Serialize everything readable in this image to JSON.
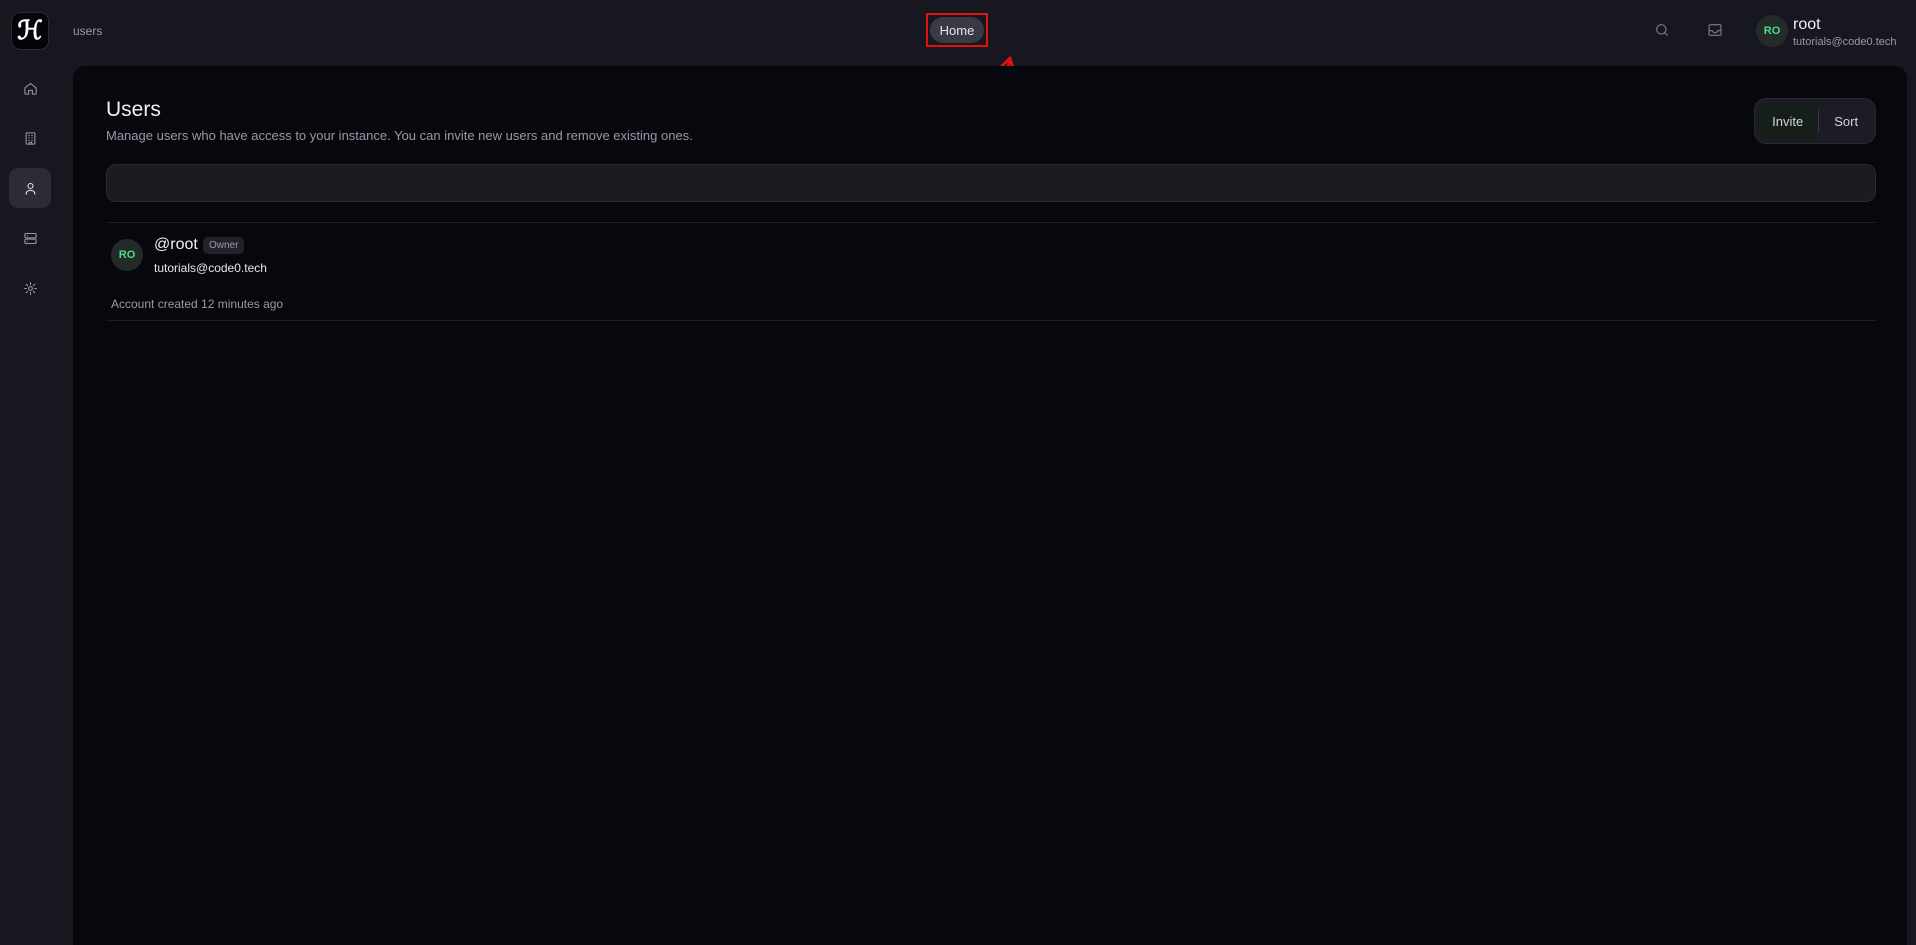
{
  "sidebar": {
    "logo_text": "ℋ",
    "items": [
      {
        "icon": "home-icon",
        "active": false
      },
      {
        "icon": "building-icon",
        "active": false
      },
      {
        "icon": "user-icon",
        "active": true
      },
      {
        "icon": "server-icon",
        "active": false
      },
      {
        "icon": "gear-icon",
        "active": false
      }
    ]
  },
  "header": {
    "breadcrumb": "users",
    "home_label": "Home",
    "user": {
      "initials": "RO",
      "name": "root",
      "email": "tutorials@code0.tech"
    }
  },
  "main": {
    "title": "Users",
    "subtitle": "Manage users who have access to your instance. You can invite new users and remove existing ones.",
    "invite_label": "Invite",
    "sort_label": "Sort",
    "search": {
      "value": "",
      "placeholder": ""
    },
    "users": [
      {
        "initials": "RO",
        "handle": "@root",
        "badge": "Owner",
        "email": "tutorials@code0.tech",
        "created": "Account created 12 minutes ago"
      }
    ]
  },
  "colors": {
    "background": "#17171f",
    "panel": "#07070e",
    "avatar_text": "#4ade80",
    "annotation": "#e0120f"
  }
}
